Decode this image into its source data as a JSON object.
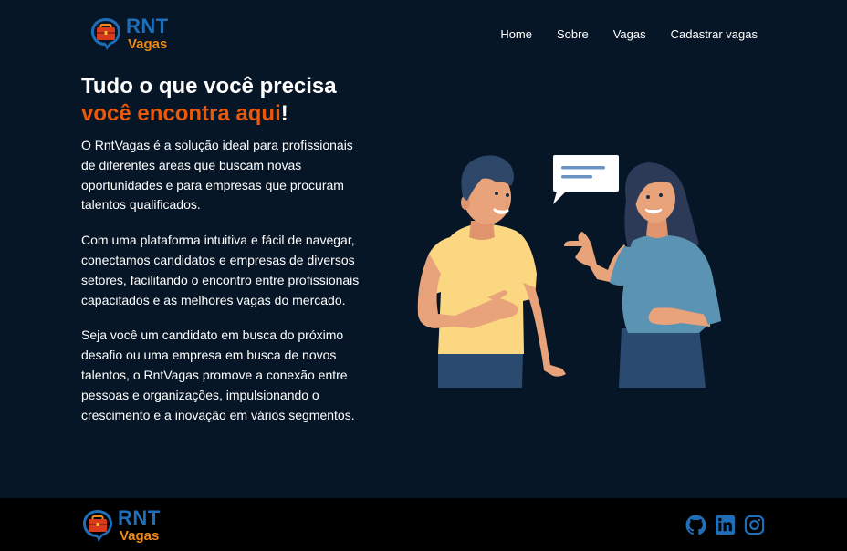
{
  "brand": {
    "top": "RNT",
    "bottom": "Vagas",
    "colors": {
      "blue": "#1f6fb8",
      "orange": "#f08a12"
    }
  },
  "nav": {
    "items": [
      {
        "label": "Home"
      },
      {
        "label": "Sobre"
      },
      {
        "label": "Vagas"
      },
      {
        "label": "Cadastrar vagas"
      }
    ]
  },
  "hero": {
    "title_line1": "Tudo o que você precisa",
    "title_accent": "você encontra aqui",
    "title_end": "!",
    "accent_color": "#e8590c",
    "paragraphs": [
      "O RntVagas é a solução ideal para profissionais de diferentes áreas que buscam novas oportunidades e para empresas que procuram talentos qualificados.",
      "Com uma plataforma intuitiva e fácil de navegar, conectamos candidatos e empresas de diversos setores, facilitando o encontro entre profissionais capacitados e as melhores vagas do mercado.",
      "Seja você um candidato em busca do próximo desafio ou uma empresa em busca de novos talentos, o RntVagas promove a conexão entre pessoas e organizações, impulsionando o crescimento e a inovação em vários segmentos."
    ]
  },
  "footer": {
    "social_icons": [
      "github-icon",
      "linkedin-icon",
      "instagram-icon"
    ],
    "icon_color": "#1f6fb8"
  },
  "colors": {
    "background": "#061627",
    "footer_background": "#000000"
  }
}
